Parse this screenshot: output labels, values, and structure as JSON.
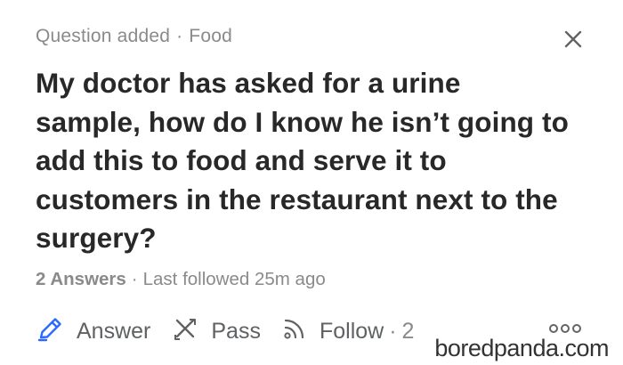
{
  "header": {
    "status": "Question added",
    "separator": "·",
    "topic": "Food"
  },
  "question": {
    "text": "My doctor has asked for a urine sample, how do I know he isn’t going to add this to food and serve it to customers in the restaurant next to the surgery?"
  },
  "stats": {
    "answers": "2 Answers",
    "separator": "·",
    "last_followed": "Last followed 25m ago"
  },
  "actions": {
    "answer_label": "Answer",
    "pass_label": "Pass",
    "follow_label": "Follow",
    "follow_separator": "·",
    "follow_count": "2"
  },
  "icons": {
    "close": "close-icon",
    "answer": "pencil-icon",
    "pass": "pass-icon",
    "follow": "rss-icon",
    "more": "more-icon"
  },
  "colors": {
    "accent": "#2e69ff",
    "text": "#282829",
    "muted": "#8a8a8a",
    "action": "#5f6163"
  },
  "watermark": "boredpanda.com"
}
